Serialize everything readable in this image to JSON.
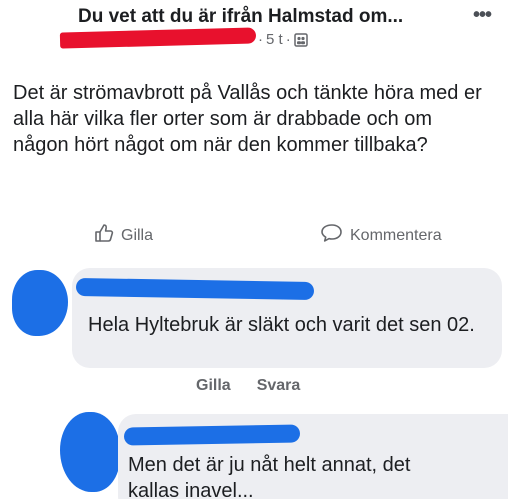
{
  "header": {
    "group_title": "Du vet att du är ifrån Halmstad om...",
    "time": "5 t",
    "separator": "·",
    "more_icon": "more-horizontal-icon",
    "audience_icon": "group-audience-icon",
    "redaction_color": "#e8112d"
  },
  "post": {
    "text": "Det är strömavbrott på Vallås och tänkte höra med er alla här vilka fler orter som är drabbade och om någon hört något om när den kommer tillbaka?"
  },
  "actions": {
    "like_label": "Gilla",
    "comment_label": "Kommentera"
  },
  "comments": [
    {
      "text": "Hela Hyltebruk är släkt och varit det sen 02.",
      "like_label": "Gilla",
      "reply_label": "Svara"
    },
    {
      "text": "Men det är ju nåt helt annat, det kallas inavel..."
    }
  ],
  "colors": {
    "text": "#1c1e21",
    "secondary": "#65676b",
    "bubble": "#edeef2",
    "scribble_blue": "#1c6fe6"
  }
}
